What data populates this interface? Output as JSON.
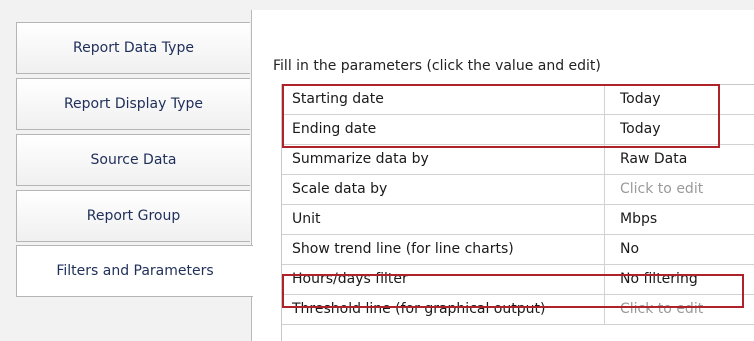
{
  "tabs": [
    {
      "label": "Report Data Type",
      "active": false
    },
    {
      "label": "Report Display Type",
      "active": false
    },
    {
      "label": "Source Data",
      "active": false
    },
    {
      "label": "Report Group",
      "active": false
    },
    {
      "label": "Filters and Parameters",
      "active": true
    }
  ],
  "instructions": "Fill in the parameters (click the value and edit)",
  "parameters": [
    {
      "label": "Starting date",
      "value": "Today"
    },
    {
      "label": "Ending date",
      "value": "Today"
    },
    {
      "label": "Summarize data by",
      "value": "Raw Data"
    },
    {
      "label": "Scale data by",
      "value": "Click to edit"
    },
    {
      "label": "Unit",
      "value": "Mbps"
    },
    {
      "label": "Show trend line (for line charts)",
      "value": "No"
    },
    {
      "label": "Hours/days filter",
      "value": "No filtering"
    },
    {
      "label": "Threshold line (for graphical output)",
      "value": "Click to edit"
    }
  ],
  "colors": {
    "highlight": "#b0222a",
    "tab_text": "#1f2f5a",
    "placeholder_text": "#9a9a9a"
  }
}
